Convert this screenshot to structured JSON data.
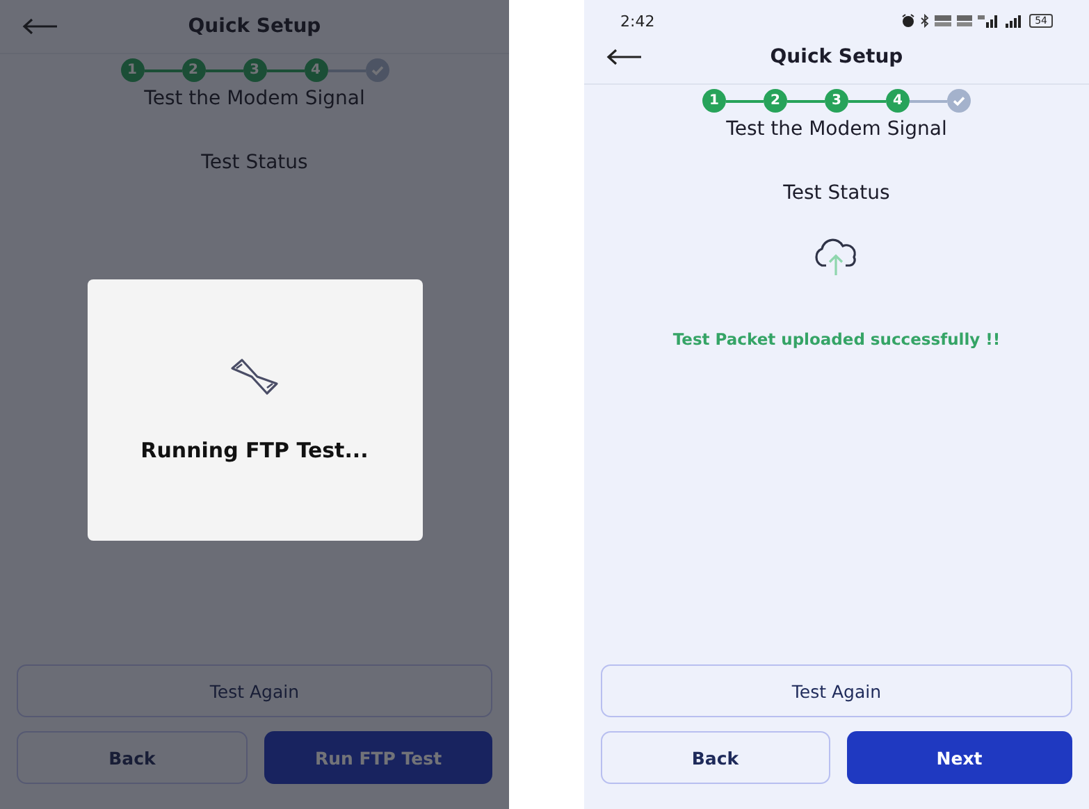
{
  "screens": [
    {
      "header": {
        "title": "Quick Setup"
      },
      "steps": [
        {
          "label": "1",
          "completed": true,
          "kind": "number"
        },
        {
          "label": "2",
          "completed": true,
          "kind": "number"
        },
        {
          "label": "3",
          "completed": true,
          "kind": "number"
        },
        {
          "label": "4",
          "completed": true,
          "kind": "number"
        },
        {
          "completed": false,
          "kind": "check"
        }
      ],
      "subtitle": "Test the Modem Signal",
      "status_heading": "Test Status",
      "dialog": {
        "text": "Running FTP Test..."
      },
      "buttons": [
        {
          "label": "Test Again",
          "kind": "wide"
        },
        {
          "label": "Back",
          "kind": "outline"
        },
        {
          "label": "Run FTP Test",
          "kind": "primary"
        }
      ]
    },
    {
      "status_bar": {
        "time": "2:42",
        "battery": "54"
      },
      "header": {
        "title": "Quick Setup"
      },
      "steps": [
        {
          "label": "1",
          "completed": true,
          "kind": "number"
        },
        {
          "label": "2",
          "completed": true,
          "kind": "number"
        },
        {
          "label": "3",
          "completed": true,
          "kind": "number"
        },
        {
          "label": "4",
          "completed": true,
          "kind": "number"
        },
        {
          "completed": false,
          "kind": "check"
        }
      ],
      "subtitle": "Test the Modem Signal",
      "status_heading": "Test Status",
      "result": {
        "message": "Test Packet uploaded successfully !!"
      },
      "buttons": [
        {
          "label": "Test Again",
          "kind": "wide"
        },
        {
          "label": "Back",
          "kind": "outline"
        },
        {
          "label": "Next",
          "kind": "primary"
        }
      ]
    }
  ]
}
